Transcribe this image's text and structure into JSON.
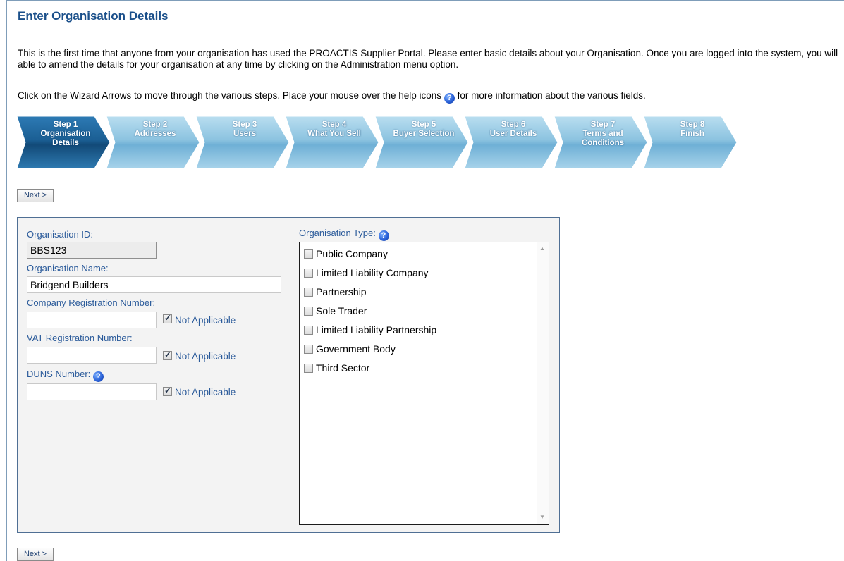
{
  "page": {
    "title": "Enter Organisation Details",
    "intro": "This is the first time that anyone from your organisation has used the PROACTIS Supplier Portal. Please enter basic details about your Organisation. Once you are logged into the system, you will able to amend the details for your organisation at any time by clicking on the Administration menu option.",
    "hint_before": "Click on the Wizard Arrows to move through the various steps. Place your mouse over the help icons",
    "hint_after": "for more information about the various fields."
  },
  "wizard": {
    "steps": [
      {
        "line1": "Step 1",
        "line2": "Organisation",
        "line3": "Details",
        "active": true
      },
      {
        "line1": "Step 2",
        "line2": "Addresses",
        "line3": "",
        "active": false
      },
      {
        "line1": "Step 3",
        "line2": "Users",
        "line3": "",
        "active": false
      },
      {
        "line1": "Step 4",
        "line2": "What You Sell",
        "line3": "",
        "active": false
      },
      {
        "line1": "Step 5",
        "line2": "Buyer Selection",
        "line3": "",
        "active": false
      },
      {
        "line1": "Step 6",
        "line2": "User Details",
        "line3": "",
        "active": false
      },
      {
        "line1": "Step 7",
        "line2": "Terms and",
        "line3": "Conditions",
        "active": false
      },
      {
        "line1": "Step 8",
        "line2": "Finish",
        "line3": "",
        "active": false
      }
    ]
  },
  "buttons": {
    "next_label": "Next >"
  },
  "form": {
    "org_id_label": "Organisation ID:",
    "org_id_value": "BBS123",
    "org_name_label": "Organisation Name:",
    "org_name_value": "Bridgend Builders",
    "company_reg_label": "Company Registration Number:",
    "company_reg_value": "",
    "vat_reg_label": "VAT Registration Number:",
    "vat_reg_value": "",
    "duns_label": "DUNS Number:",
    "duns_value": "",
    "not_applicable_label": "Not Applicable",
    "company_reg_na_checked": true,
    "vat_reg_na_checked": true,
    "duns_na_checked": true,
    "org_type_label": "Organisation Type:",
    "org_types": [
      {
        "label": "Public Company",
        "checked": false
      },
      {
        "label": "Limited Liability Company",
        "checked": false
      },
      {
        "label": "Partnership",
        "checked": false
      },
      {
        "label": "Sole Trader",
        "checked": false
      },
      {
        "label": "Limited Liability Partnership",
        "checked": false
      },
      {
        "label": "Government Body",
        "checked": false
      },
      {
        "label": "Third Sector",
        "checked": false
      }
    ]
  },
  "colors": {
    "title": "#1a4f8a",
    "label": "#2a5a9a",
    "step_active": "#1b5f94",
    "step_inactive": "#8cc3e0"
  },
  "icons": {
    "help": "help-question-icon"
  }
}
